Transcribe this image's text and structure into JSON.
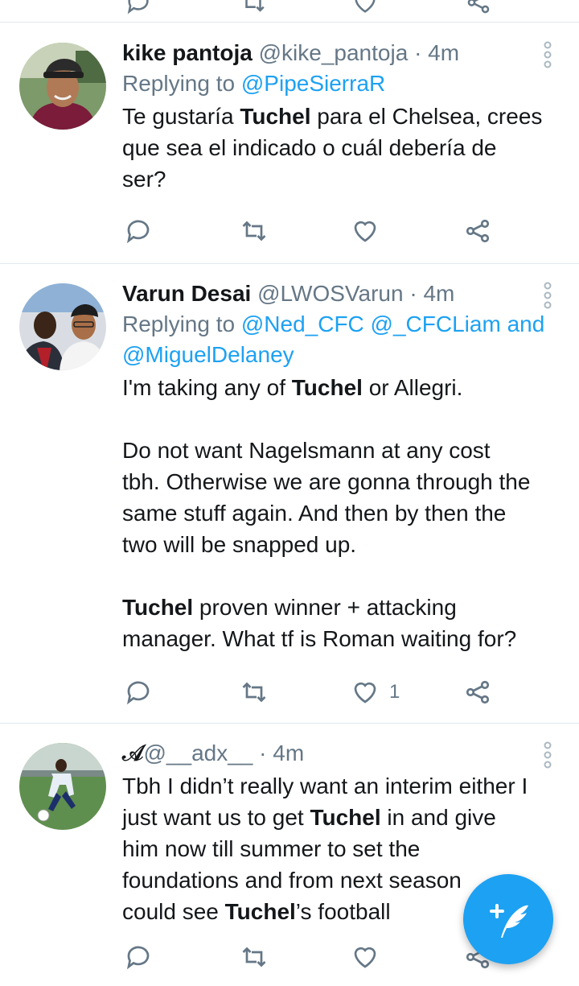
{
  "tweets": [
    {
      "display_name": "kike pantoja",
      "handle": "@kike_pantoja",
      "separator": "·",
      "time": "4m",
      "replying_prefix": "Replying to ",
      "replying_to": "@PipeSierraR",
      "replying_more": "",
      "text_parts": [
        {
          "t": "Te gustaría ",
          "b": false
        },
        {
          "t": "Tuchel",
          "b": true
        },
        {
          "t": " para el Chelsea, crees\nque sea el indicado o cuál debería de\nser?",
          "b": false
        }
      ],
      "actions": {
        "reply": "",
        "retweet": "",
        "like": "",
        "share": ""
      }
    },
    {
      "display_name": "Varun Desai",
      "handle": "@LWOSVarun",
      "separator": "·",
      "time": "4m",
      "replying_prefix": "Replying to ",
      "replying_to": "@Ned_CFC @_CFCLiam and",
      "replying_more": "@MiguelDelaney",
      "text_parts": [
        {
          "t": "I'm taking any of ",
          "b": false
        },
        {
          "t": "Tuchel",
          "b": true
        },
        {
          "t": " or Allegri.\n\nDo not want Nagelsmann at any cost\ntbh. Otherwise we are gonna through the\nsame stuff again. And then by then the\ntwo will be snapped up.\n\n",
          "b": false
        },
        {
          "t": "Tuchel",
          "b": true
        },
        {
          "t": " proven winner + attacking\nmanager. What tf is Roman waiting for?",
          "b": false
        }
      ],
      "actions": {
        "reply": "",
        "retweet": "",
        "like": "1",
        "share": ""
      }
    },
    {
      "display_name": "𝒜",
      "handle": "@__adx__",
      "separator": "·",
      "time": "4m",
      "replying_prefix": "",
      "replying_to": "",
      "replying_more": "",
      "text_parts": [
        {
          "t": "Tbh I didn’t really want an interim either I\njust want us to get ",
          "b": false
        },
        {
          "t": "Tuchel",
          "b": true
        },
        {
          "t": " in and give\nhim now till summer to set the\nfoundations and from next season\ncould see ",
          "b": false
        },
        {
          "t": "Tuchel",
          "b": true
        },
        {
          "t": "’s football",
          "b": false
        }
      ],
      "actions": {
        "reply": "",
        "retweet": "",
        "like": "",
        "share": ""
      }
    }
  ],
  "colors": {
    "accent": "#1da1f2",
    "muted": "#657786",
    "divider": "#e1e8ed"
  },
  "icons": {
    "reply": "reply-icon",
    "retweet": "retweet-icon",
    "like": "like-icon",
    "share": "share-icon",
    "more": "more-vertical-icon",
    "compose": "compose-tweet-icon"
  }
}
